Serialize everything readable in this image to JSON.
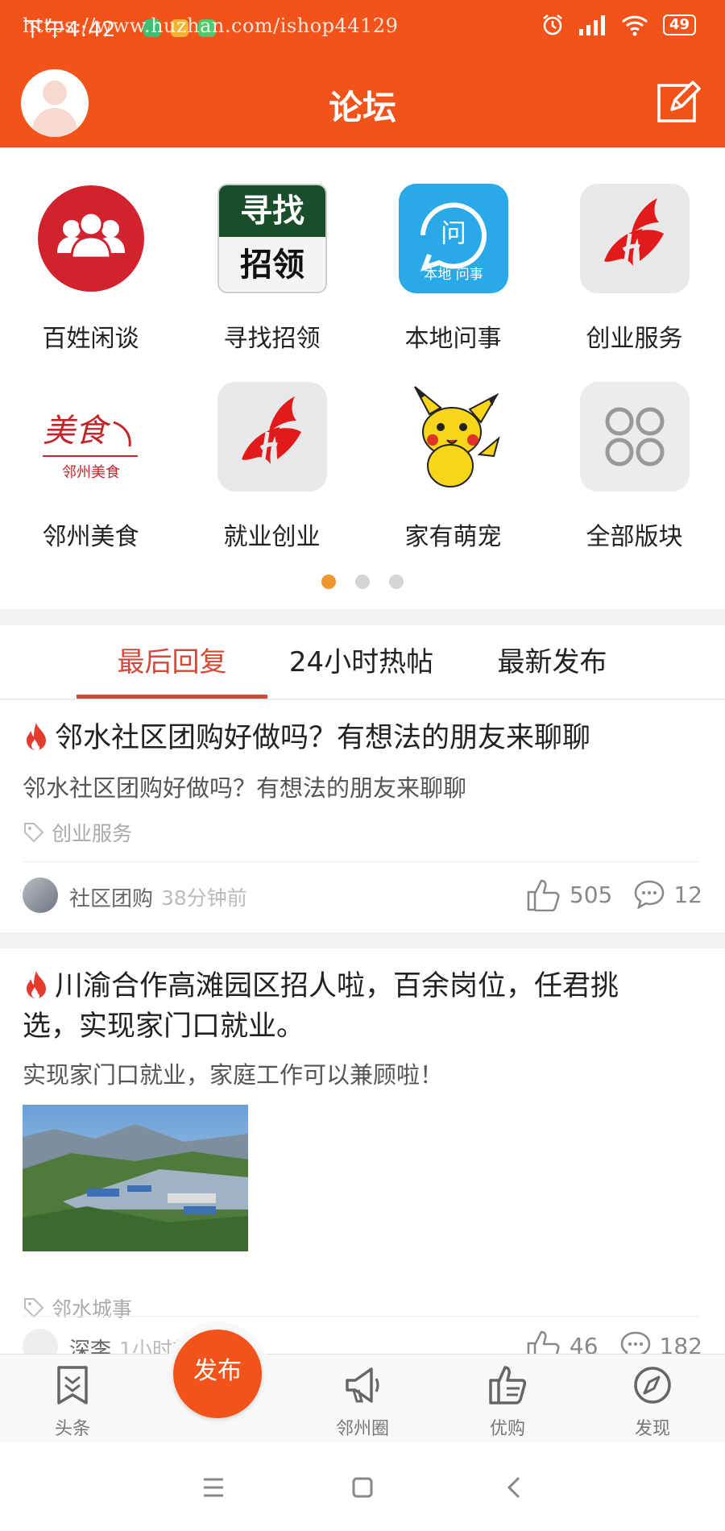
{
  "status_bar": {
    "time": "下午4:42",
    "watermark": "https://www.huzhan.com/ishop44129",
    "battery": "49",
    "icons": [
      "alarm-icon",
      "signal-icon",
      "wifi-icon",
      "battery-icon"
    ]
  },
  "header": {
    "title": "论坛",
    "background": "#f2531a",
    "left_icon": "user-avatar-icon",
    "right_icon": "edit-icon"
  },
  "forums": [
    {
      "label": "百姓闲谈",
      "icon": "people-icon"
    },
    {
      "label": "寻找招领",
      "icon": "lost-found-icon",
      "icon_text": [
        "寻找",
        "招领"
      ]
    },
    {
      "label": "本地问事",
      "icon": "ask-icon",
      "icon_text": [
        "问",
        "本地 问事"
      ]
    },
    {
      "label": "创业服务",
      "icon": "career-logo-icon"
    },
    {
      "label": "邻州美食",
      "icon": "food-logo-icon",
      "icon_text": [
        "美食",
        "邻州美食"
      ]
    },
    {
      "label": "就业创业",
      "icon": "career-logo-icon"
    },
    {
      "label": "家有萌宠",
      "icon": "pet-icon"
    },
    {
      "label": "全部版块",
      "icon": "all-sections-icon"
    }
  ],
  "pager": {
    "total": 3,
    "active": 1
  },
  "tabs": [
    {
      "label": "最后回复",
      "active": true
    },
    {
      "label": "24小时热帖",
      "active": false
    },
    {
      "label": "最新发布",
      "active": false
    }
  ],
  "posts": [
    {
      "title": "邻水社区团购好做吗？有想法的朋友来聊聊",
      "summary": "邻水社区团购好做吗？有想法的朋友来聊聊",
      "tag": "创业服务",
      "author": "社区团购",
      "time": "38分钟前",
      "likes": "505",
      "comments": "12"
    },
    {
      "title_line1": "川渝合作高滩园区招人啦，百余岗位，任君挑",
      "title_line2": "选，实现家门口就业。",
      "summary": "实现家门口就业，家庭工作可以兼顾啦！",
      "tag": "邻水城事",
      "author": "深李",
      "time": "1小时前",
      "likes": "46",
      "comments": "182"
    }
  ],
  "bottom_nav": {
    "items": [
      {
        "label": "头条",
        "icon": "headlines-icon"
      },
      {
        "label": "邻州圈",
        "icon": "megaphone-icon"
      },
      {
        "label": "优购",
        "icon": "thumbs-up-shop-icon"
      },
      {
        "label": "发现",
        "icon": "compass-icon"
      }
    ],
    "publish_label": "发布"
  },
  "system_nav": [
    "menu-icon",
    "home-icon",
    "back-icon"
  ]
}
